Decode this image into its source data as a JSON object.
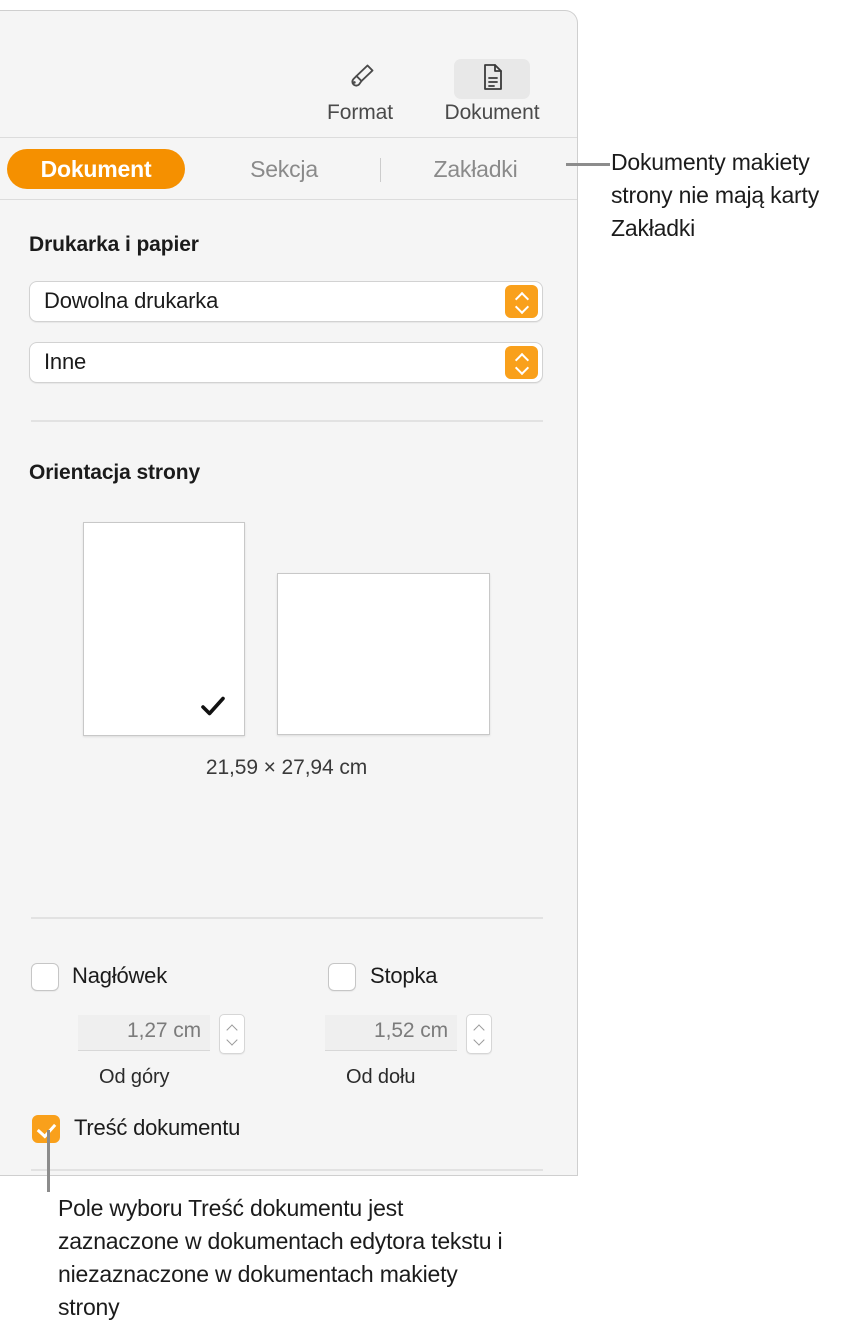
{
  "toolbar": {
    "buttons": [
      {
        "label": "Format",
        "icon": "paintbrush-icon",
        "active": false
      },
      {
        "label": "Dokument",
        "icon": "document-page-icon",
        "active": true
      }
    ]
  },
  "tabs": [
    {
      "label": "Dokument",
      "selected": true
    },
    {
      "label": "Sekcja",
      "selected": false
    },
    {
      "label": "Zakładki",
      "selected": false
    }
  ],
  "printer_section": {
    "title": "Drukarka i papier",
    "printer_popup": {
      "value": "Dowolna drukarka",
      "icon": "updown-chevron-icon"
    },
    "paper_popup": {
      "value": "Inne",
      "icon": "updown-chevron-icon"
    }
  },
  "orientation_section": {
    "title": "Orientacja strony",
    "portrait": {
      "name": "portrait",
      "selected": true,
      "check_icon": "checkmark-icon"
    },
    "landscape": {
      "name": "landscape",
      "selected": false
    },
    "paper_size": "21,59 × 27,94 cm"
  },
  "header_footer_section": {
    "header": {
      "label": "Nagłówek",
      "checked": false,
      "value": "1,27 cm",
      "sub_label": "Od góry"
    },
    "footer": {
      "label": "Stopka",
      "checked": false,
      "value": "1,52 cm",
      "sub_label": "Od dołu"
    },
    "body": {
      "label": "Treść dokumentu",
      "checked": true
    }
  },
  "callouts": {
    "top": "Dokumenty makiety strony nie mają karty Zakładki",
    "bottom": "Pole wyboru Treść dokumentu jest zaznaczone w dokumentach edytora tekstu i niezaznaczone w dokumentach makiety strony"
  },
  "colors": {
    "accent_orange": "#f59000",
    "control_orange": "#f9a01b",
    "panel_bg": "#f5f5f5",
    "text_primary": "#1b1b1b",
    "text_secondary": "#8a8a8a"
  }
}
